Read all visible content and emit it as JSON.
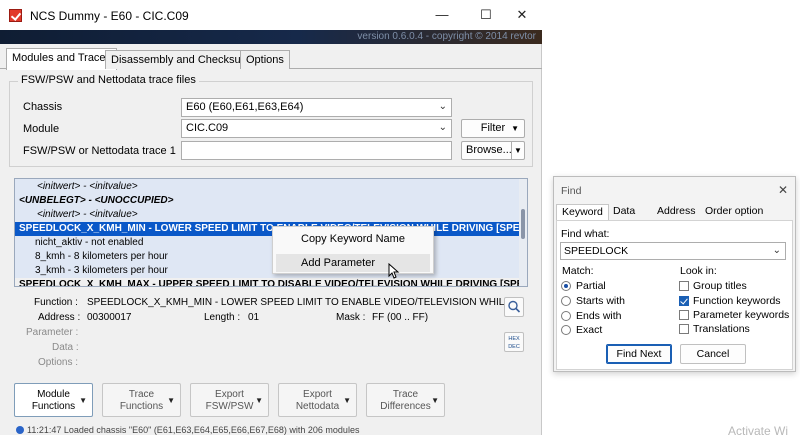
{
  "window": {
    "title": "NCS Dummy - E60 - CIC.C09",
    "banner_text": "version 0.6.0.4 - copyright © 2014 revtor",
    "minimize": "—",
    "maximize": "☐",
    "close": "✕"
  },
  "tabs": [
    "Modules and Traces",
    "Disassembly and Checksums",
    "Options"
  ],
  "group": {
    "title": "FSW/PSW and Nettodata trace files",
    "chassis_label": "Chassis",
    "chassis_value": "E60  (E60,E61,E63,E64)",
    "module_label": "Module",
    "module_value": "CIC.C09",
    "filter_button": "Filter",
    "trace_label": "FSW/PSW or Nettodata trace 1",
    "trace_value": "",
    "browse_button": "Browse..."
  },
  "trace_rows": [
    "<initwert>  -  <initvalue>",
    "<UNBELEGT>  -  <UNOCCUPIED>",
    "<initwert>  -  <initvalue>",
    "SPEEDLOCK_X_KMH_MIN  -  LOWER SPEED LIMIT TO ENABLE VIDEO/TELEVISION WHILE DRIVING [SPEED_KM/H=D",
    "nicht_aktiv  -  not enabled",
    "8_kmh  -  8 kilometers per hour",
    "3_kmh  -  3 kilometers per hour",
    "SPEEDLOCK_X_KMH_MAX  -  UPPER SPEED LIMIT TO DISABLE VIDEO/TELEVISION WHILE DRIVING [SPEED_KM/H=E"
  ],
  "context_menu": [
    "Copy Keyword Name",
    "Add Parameter"
  ],
  "details": {
    "function_label": "Function :",
    "function_value": "SPEEDLOCK_X_KMH_MIN  -  LOWER SPEED LIMIT TO ENABLE VIDEO/TELEVISION WHILE DRIVING [",
    "address_label": "Address :",
    "address_value": "00300017",
    "length_label": "Length :",
    "length_value": "01",
    "mask_label": "Mask :",
    "mask_value": "FF  (00 .. FF)",
    "parameter_label": "Parameter :",
    "data_label": "Data :",
    "options_label": "Options :",
    "hex_button": "HEX DEC"
  },
  "bottom_buttons": [
    [
      "Module",
      "Functions"
    ],
    [
      "Trace",
      "Functions"
    ],
    [
      "Export",
      "FSW/PSW"
    ],
    [
      "Export",
      "Nettodata"
    ],
    [
      "Trace",
      "Differences"
    ]
  ],
  "status_text": "11:21:47  Loaded chassis \"E60\" (E61,E63,E64,E65,E66,E67,E68) with 206 modules",
  "find": {
    "title": "Find",
    "close": "✕",
    "tabs": [
      "Keyword",
      "Data",
      "Address",
      "Order option"
    ],
    "find_what_label": "Find what:",
    "find_what_value": "SPEEDLOCK",
    "match_label": "Match:",
    "match_options": [
      "Partial",
      "Starts with",
      "Ends with",
      "Exact"
    ],
    "look_in_label": "Look in:",
    "look_in_options": [
      "Group titles",
      "Function keywords",
      "Parameter keywords",
      "Translations"
    ],
    "find_next": "Find Next",
    "cancel": "Cancel"
  },
  "watermark": "Activate Wi"
}
